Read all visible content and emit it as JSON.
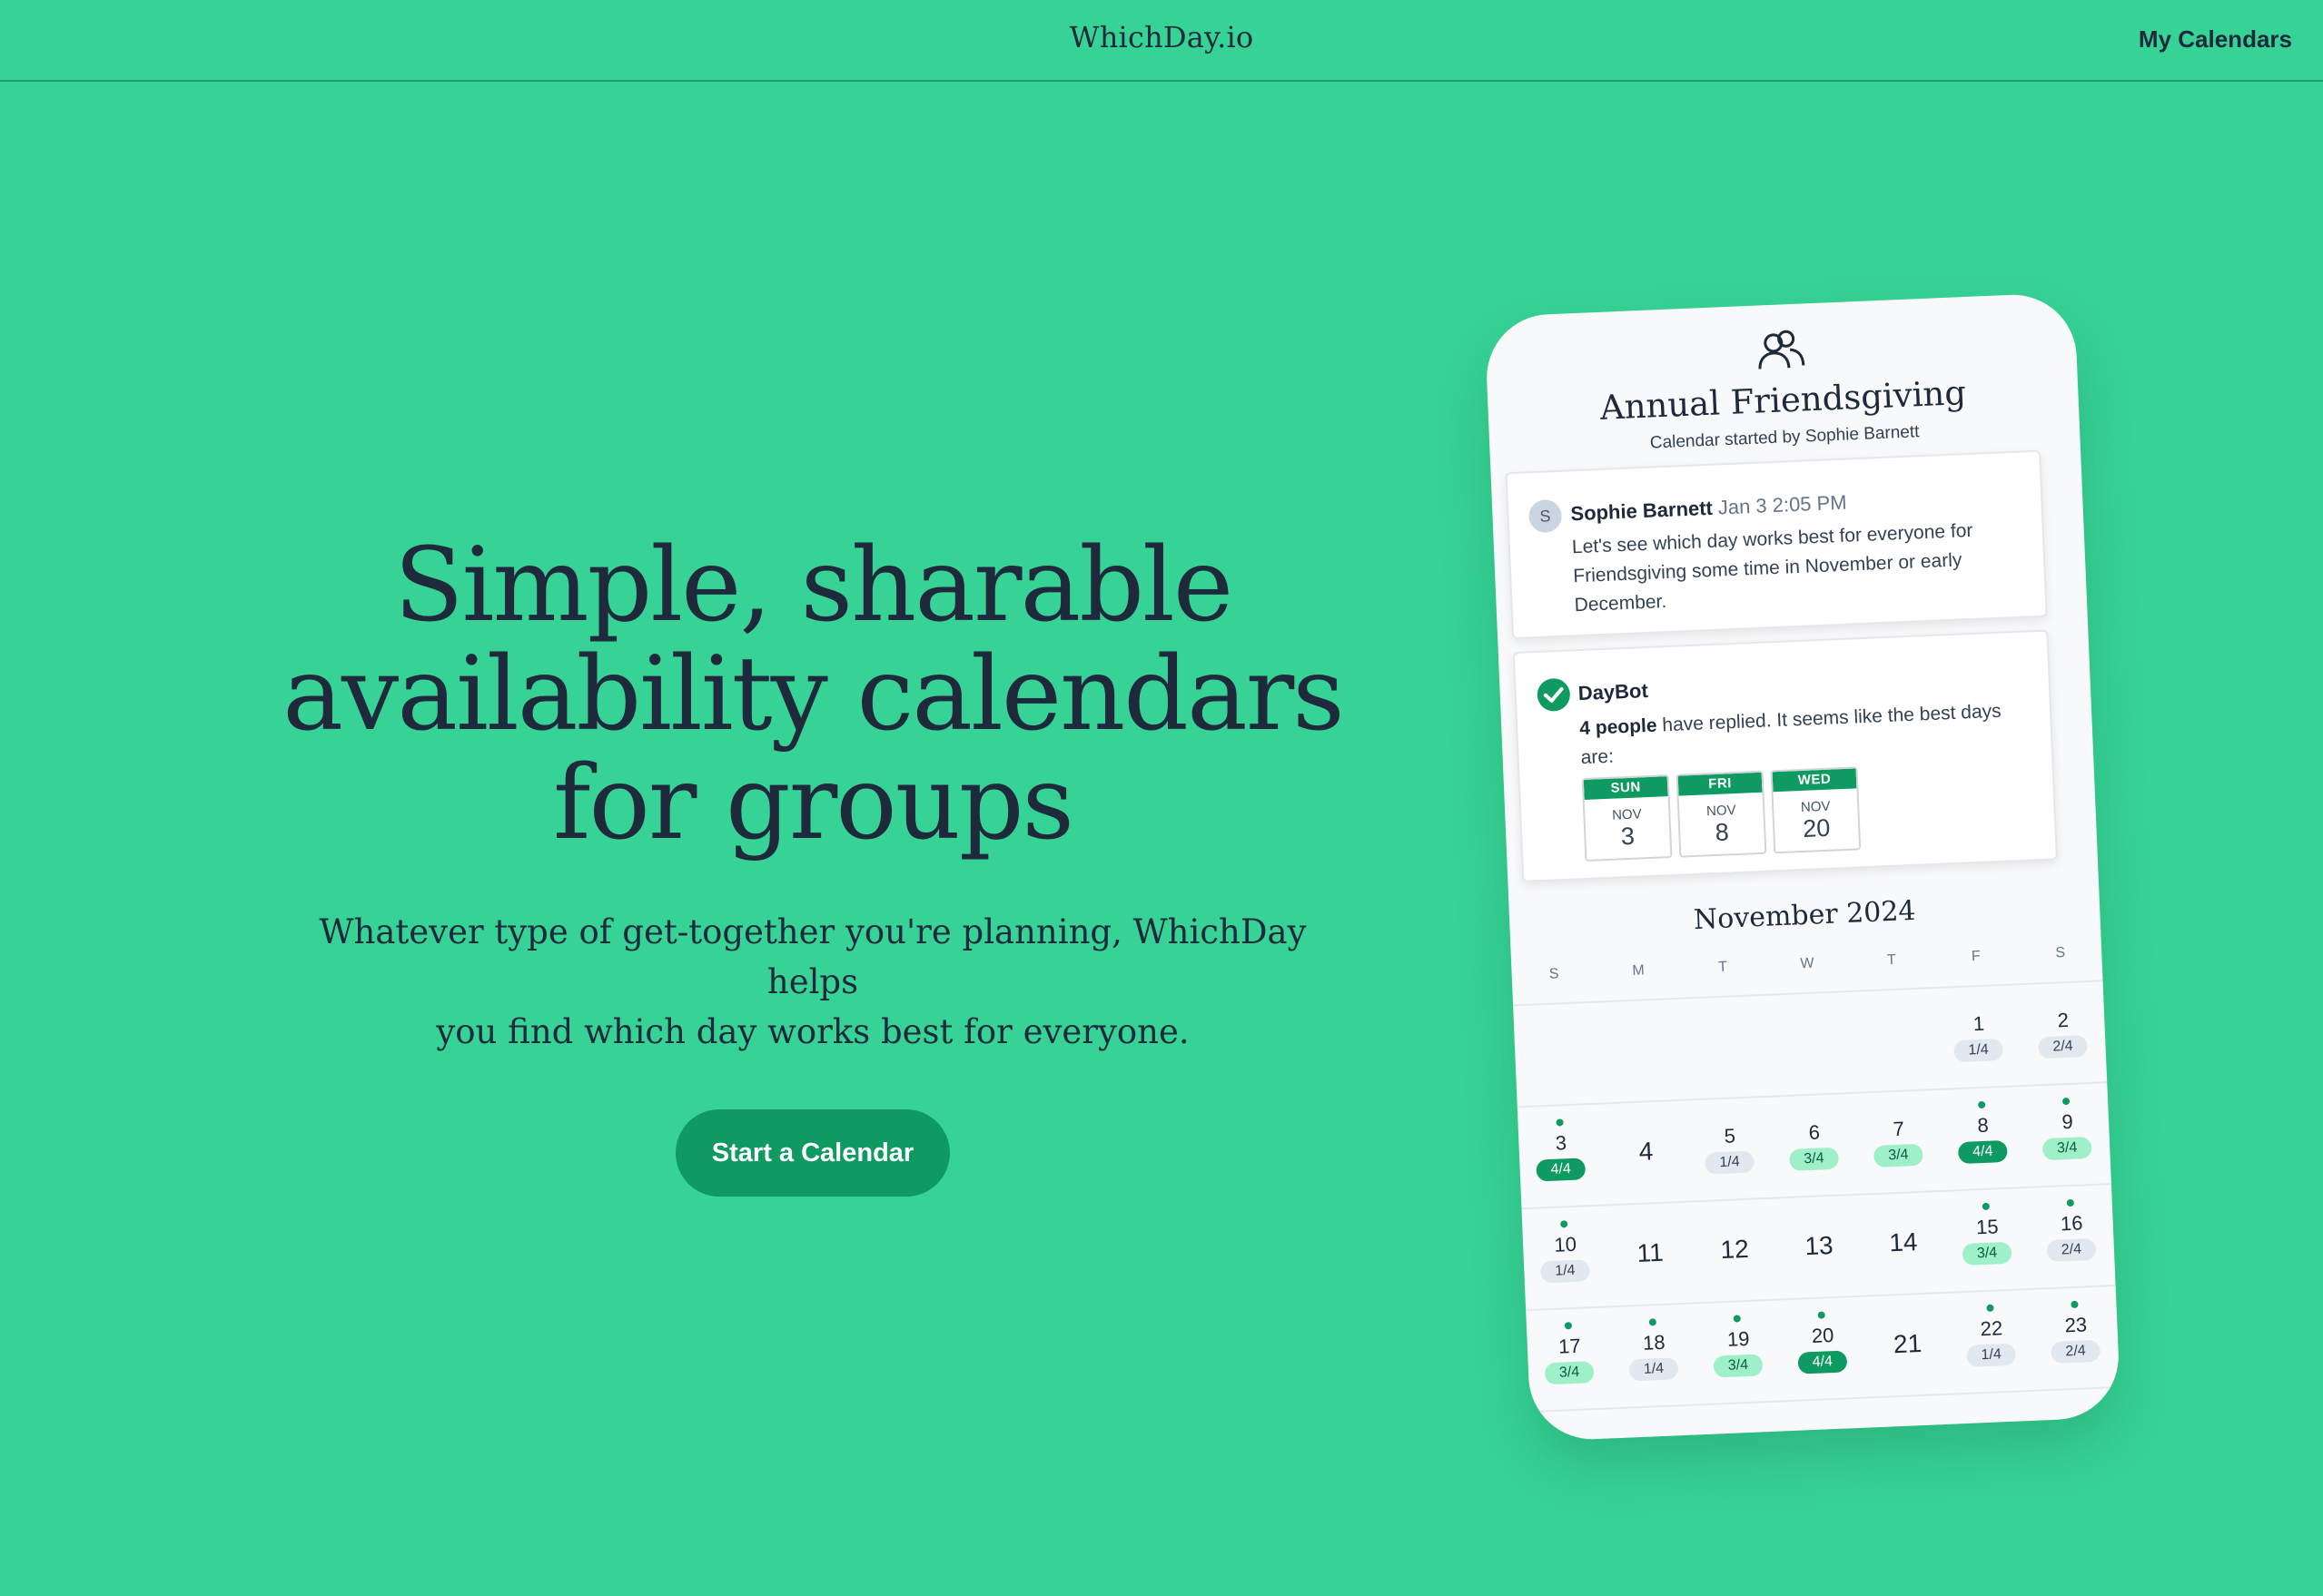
{
  "header": {
    "brand": "WhichDay.io",
    "nav_link": "My Calendars"
  },
  "hero": {
    "title_line1": "Simple, sharable",
    "title_line2": "availability calendars",
    "title_line3": "for groups",
    "subtitle_line1": "Whatever type of get-together you're planning, WhichDay helps",
    "subtitle_line2": "you find which day works best for everyone.",
    "cta_label": "Start a Calendar"
  },
  "mockup": {
    "icon": "group-icon",
    "title": "Annual Friendsgiving",
    "subtitle": "Calendar started by Sophie Barnett",
    "message": {
      "avatar_initial": "S",
      "author": "Sophie Barnett",
      "time": "Jan 3 2:05 PM",
      "text": "Let's see which day works best for everyone for Friendsgiving some time in November or early December."
    },
    "bot": {
      "name": "DayBot",
      "count_text": "4 people",
      "text": "have replied. It seems like the best days are:",
      "best_days": [
        {
          "dow": "SUN",
          "month": "NOV",
          "day": "3"
        },
        {
          "dow": "FRI",
          "month": "NOV",
          "day": "8"
        },
        {
          "dow": "WED",
          "month": "NOV",
          "day": "20"
        }
      ]
    },
    "calendar": {
      "month": "November 2024",
      "weekdays": [
        "S",
        "M",
        "T",
        "W",
        "T",
        "F",
        "S"
      ],
      "weeks": [
        [
          null,
          null,
          null,
          null,
          null,
          {
            "day": "1",
            "badge": "1/4",
            "level": "gray"
          },
          {
            "day": "2",
            "badge": "2/4",
            "level": "gray"
          }
        ],
        [
          {
            "day": "3",
            "badge": "4/4",
            "level": "dark",
            "dot": true
          },
          {
            "day": "4"
          },
          {
            "day": "5",
            "badge": "1/4",
            "level": "gray"
          },
          {
            "day": "6",
            "badge": "3/4",
            "level": "light"
          },
          {
            "day": "7",
            "badge": "3/4",
            "level": "light"
          },
          {
            "day": "8",
            "badge": "4/4",
            "level": "dark",
            "dot": true
          },
          {
            "day": "9",
            "badge": "3/4",
            "level": "light",
            "dot": true
          }
        ],
        [
          {
            "day": "10",
            "badge": "1/4",
            "level": "gray",
            "dot": true
          },
          {
            "day": "11"
          },
          {
            "day": "12"
          },
          {
            "day": "13"
          },
          {
            "day": "14"
          },
          {
            "day": "15",
            "badge": "3/4",
            "level": "light",
            "dot": true
          },
          {
            "day": "16",
            "badge": "2/4",
            "level": "gray",
            "dot": true
          }
        ],
        [
          {
            "day": "17",
            "badge": "3/4",
            "level": "light",
            "dot": true
          },
          {
            "day": "18",
            "badge": "1/4",
            "level": "gray",
            "dot": true
          },
          {
            "day": "19",
            "badge": "3/4",
            "level": "light",
            "dot": true
          },
          {
            "day": "20",
            "badge": "4/4",
            "level": "dark",
            "dot": true
          },
          {
            "day": "21"
          },
          {
            "day": "22",
            "badge": "1/4",
            "level": "gray",
            "dot": true
          },
          {
            "day": "23",
            "badge": "2/4",
            "level": "gray",
            "dot": true
          }
        ]
      ]
    }
  },
  "colors": {
    "background": "#37d396",
    "accent": "#0f9a62",
    "text": "#1e293b"
  }
}
